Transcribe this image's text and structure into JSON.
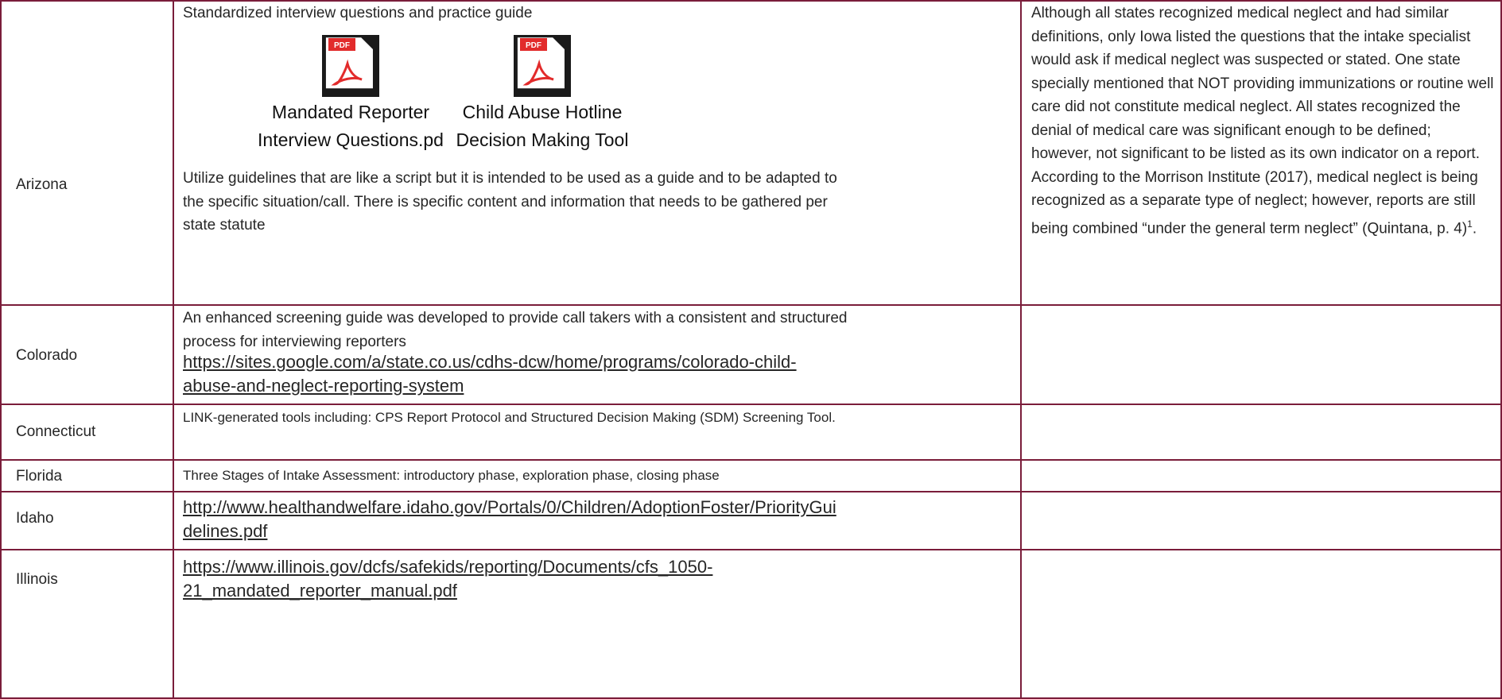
{
  "rows": [
    {
      "state": "Arizona",
      "intro": "Standardized interview questions and practice guide",
      "attachments": [
        {
          "icon": "pdf-file-icon",
          "badge": "PDF",
          "caption_line1": "Mandated Reporter",
          "caption_line2": "Interview Questions.pd"
        },
        {
          "icon": "pdf-file-icon",
          "badge": "PDF",
          "caption_line1": "Child Abuse Hotline",
          "caption_line2": "Decision Making Tool"
        }
      ],
      "body": "Utilize guidelines that are like a script but it is intended to be used as a guide and to be adapted to the specific situation/call. There is specific content and information that needs to be gathered per state statute",
      "notes": "Although all states recognized medical neglect and had similar definitions, only Iowa listed the questions that the intake specialist would ask if medical neglect was suspected or stated. One state specially mentioned that NOT providing immunizations or routine well care did not constitute medical neglect. All states recognized the denial of medical care was significant enough to be defined; however, not significant to be listed as its own indicator on a report. According to the Morrison Institute (2017), medical neglect is being recognized as a separate type of neglect; however, reports are still being combined “under the general term neglect” (Quintana, p. 4)",
      "notes_sup": "1",
      "notes_end": "."
    },
    {
      "state": "Colorado",
      "body": "An enhanced screening guide was developed to provide call takers with a consistent and structured process for interviewing reporters",
      "link_line1": "https://sites.google.com/a/state.co.us/cdhs-dcw/home/programs/colorado-child-",
      "link_line2": "abuse-and-neglect-reporting-system"
    },
    {
      "state": "Connecticut",
      "body": "LINK-generated tools including: CPS Report Protocol and Structured Decision Making (SDM) Screening Tool."
    },
    {
      "state": "Florida",
      "body": "Three Stages of Intake Assessment: introductory phase, exploration phase, closing phase"
    },
    {
      "state": "Idaho",
      "link_line1": "http://www.healthandwelfare.idaho.gov/Portals/0/Children/AdoptionFoster/PriorityGui",
      "link_line2": "delines.pdf"
    },
    {
      "state": "Illinois",
      "link_line1": "https://www.illinois.gov/dcfs/safekids/reporting/Documents/cfs_1050-",
      "link_line2": "21_mandated_reporter_manual.pdf"
    }
  ],
  "colors": {
    "border": "#7a1d3a",
    "pdf_red": "#e22b2b",
    "pdf_dark": "#1a1a1a"
  }
}
